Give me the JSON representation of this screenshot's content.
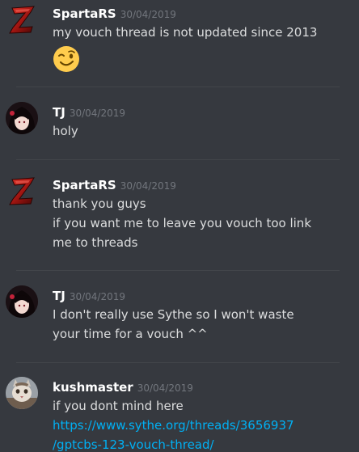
{
  "colors": {
    "background": "#36393f",
    "author": "#ffffff",
    "timestamp": "#72767d",
    "text": "#dcddde",
    "link": "#00b0f4",
    "divider": "#42454a"
  },
  "messages": [
    {
      "author": "SpartaRS",
      "timestamp": "30/04/2019",
      "avatar_icon": "red-z-logo-icon",
      "lines": [
        "my vouch thread is not updated since 2013"
      ],
      "emoji": "winking-face-emoji"
    },
    {
      "author": "TJ",
      "timestamp": "30/04/2019",
      "avatar_icon": "anime-character-avatar-icon",
      "lines": [
        "holy"
      ]
    },
    {
      "author": "SpartaRS",
      "timestamp": "30/04/2019",
      "avatar_icon": "red-z-logo-icon",
      "lines": [
        "thank you guys",
        "if you want me to leave you vouch too link",
        "me to threads"
      ]
    },
    {
      "author": "TJ",
      "timestamp": "30/04/2019",
      "avatar_icon": "anime-character-avatar-icon",
      "lines": [
        "I don't really use Sythe so I won't waste",
        "your time for a vouch ^^"
      ]
    },
    {
      "author": "kushmaster",
      "timestamp": "30/04/2019",
      "avatar_icon": "cat-avatar-icon",
      "lines": [
        "if you dont mind here"
      ],
      "link_lines": [
        "https://www.sythe.org/threads/3656937",
        "/gptcbs-123-vouch-thread/"
      ]
    }
  ]
}
